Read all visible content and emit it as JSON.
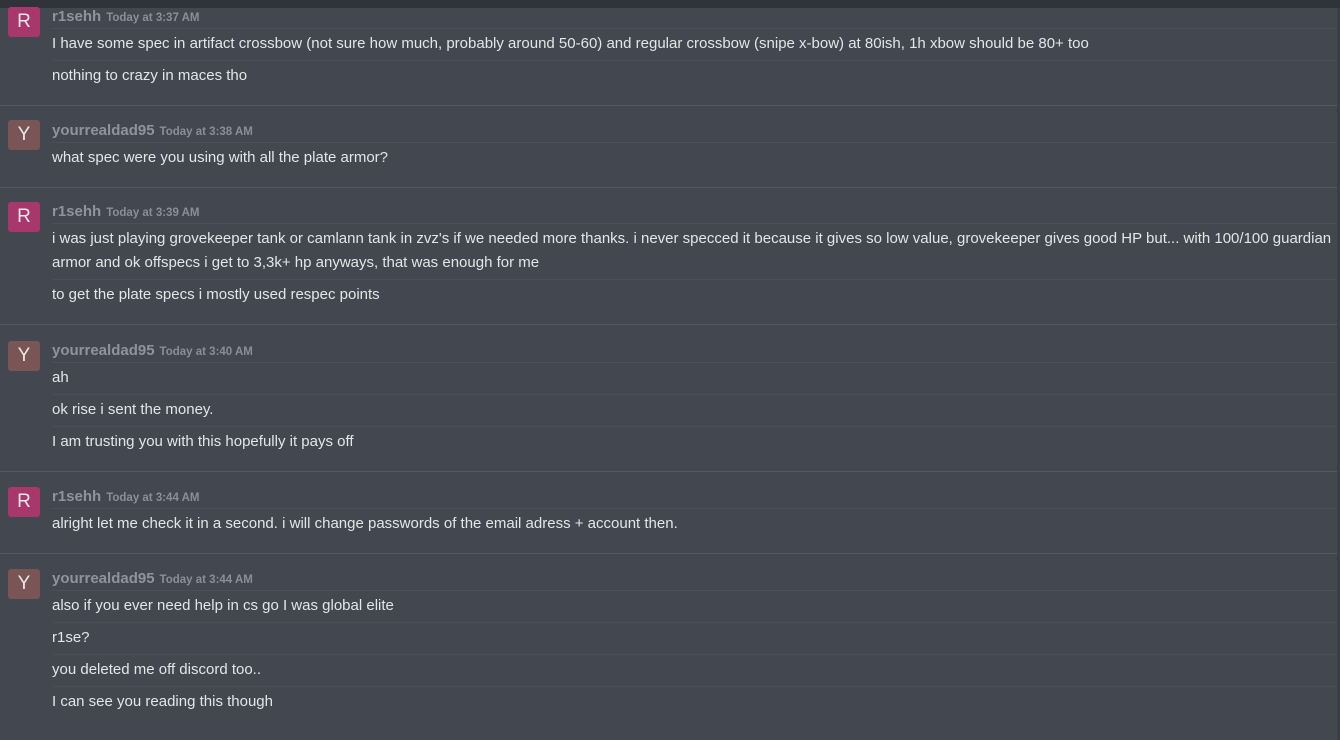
{
  "colors": {
    "background": "#424750",
    "avatar_r": "#a8386c",
    "avatar_y": "#7a5556"
  },
  "groups": [
    {
      "avatar_letter": "R",
      "username": "r1sehh",
      "timestamp": "Today at 3:37 AM",
      "messages": [
        "I have some spec in artifact crossbow (not sure how much, probably around 50-60) and regular crossbow (snipe x-bow) at 80ish, 1h xbow should be 80+ too",
        "nothing to crazy in maces tho"
      ]
    },
    {
      "avatar_letter": "Y",
      "username": "yourrealdad95",
      "timestamp": "Today at 3:38 AM",
      "messages": [
        "what spec were you using with all the plate armor?"
      ]
    },
    {
      "avatar_letter": "R",
      "username": "r1sehh",
      "timestamp": "Today at 3:39 AM",
      "messages": [
        "i was just playing grovekeeper tank or camlann tank in zvz's if we needed more thanks. i never specced it because it gives so low value, grovekeeper gives good HP but... with 100/100 guardian armor and ok offspecs i get to 3,3k+ hp anyways, that was enough for me",
        "to get the plate specs i mostly used respec points"
      ]
    },
    {
      "avatar_letter": "Y",
      "username": "yourrealdad95",
      "timestamp": "Today at 3:40 AM",
      "messages": [
        "ah",
        "ok rise i sent the money.",
        "I am trusting you with this hopefully it pays off"
      ]
    },
    {
      "avatar_letter": "R",
      "username": "r1sehh",
      "timestamp": "Today at 3:44 AM",
      "messages": [
        "alright let me check it in a second. i will change passwords of the email adress + account then."
      ]
    },
    {
      "avatar_letter": "Y",
      "username": "yourrealdad95",
      "timestamp": "Today at 3:44 AM",
      "messages": [
        "also if you ever need help in cs go I was global elite",
        "r1se?",
        "you deleted me off discord too..",
        "I can see you reading this though"
      ]
    }
  ]
}
